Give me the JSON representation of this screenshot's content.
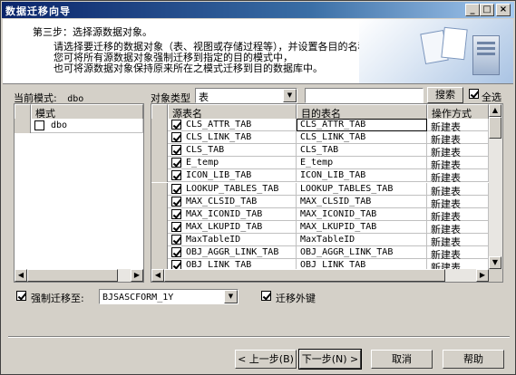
{
  "window": {
    "title": "数据迁移向导"
  },
  "header": {
    "step_title": "第三步：选择源数据对象。",
    "desc_lines": [
      "请选择要迁移的数据对象（表、视图或存储过程等），并设置各目的名称和迁移方式。",
      "您可将所有源数据对象强制迁移到指定的目的模式中，",
      "也可将源数据对象保持原来所在之模式迁移到目的数据库中。"
    ]
  },
  "schema": {
    "current_label": "当前模式:",
    "current_value": "dbo",
    "column_header": "模式",
    "rows": [
      {
        "name": "dbo",
        "checked": false
      }
    ]
  },
  "filter": {
    "object_type_label": "对象类型",
    "object_type_value": "表",
    "search_value": "",
    "search_button": "搜索",
    "select_all_label": "全选",
    "select_all_checked": true
  },
  "object_table": {
    "columns": [
      "源表名",
      "目的表名",
      "操作方式"
    ],
    "rows": [
      {
        "checked": true,
        "source": "CLS_ATTR_TAB",
        "target": "CLS_ATTR_TAB",
        "mode": "新建表"
      },
      {
        "checked": true,
        "source": "CLS_LINK_TAB",
        "target": "CLS_LINK_TAB",
        "mode": "新建表"
      },
      {
        "checked": true,
        "source": "CLS_TAB",
        "target": "CLS_TAB",
        "mode": "新建表"
      },
      {
        "checked": true,
        "source": "E_temp",
        "target": "E_temp",
        "mode": "新建表"
      },
      {
        "checked": true,
        "source": "ICON_LIB_TAB",
        "target": "ICON_LIB_TAB",
        "mode": "新建表"
      },
      {
        "checked": true,
        "source": "LOOKUP_TABLES_TAB",
        "target": "LOOKUP_TABLES_TAB",
        "mode": "新建表"
      },
      {
        "checked": true,
        "source": "MAX_CLSID_TAB",
        "target": "MAX_CLSID_TAB",
        "mode": "新建表"
      },
      {
        "checked": true,
        "source": "MAX_ICONID_TAB",
        "target": "MAX_ICONID_TAB",
        "mode": "新建表"
      },
      {
        "checked": true,
        "source": "MAX_LKUPID_TAB",
        "target": "MAX_LKUPID_TAB",
        "mode": "新建表"
      },
      {
        "checked": true,
        "source": "MaxTableID",
        "target": "MaxTableID",
        "mode": "新建表"
      },
      {
        "checked": true,
        "source": "OBJ_AGGR_LINK_TAB",
        "target": "OBJ_AGGR_LINK_TAB",
        "mode": "新建表"
      },
      {
        "checked": true,
        "source": "OBJ_LINK_TAB",
        "target": "OBJ_LINK_TAB",
        "mode": "新建表"
      }
    ]
  },
  "options": {
    "force_migrate_label": "强制迁移至:",
    "force_migrate_checked": true,
    "force_migrate_target": "BJSASCFORM_1Y",
    "migrate_fk_label": "迁移外键",
    "migrate_fk_checked": true
  },
  "footer": {
    "prev": "< 上一步(B)",
    "next": "下一步(N) >",
    "cancel": "取消",
    "help": "帮助"
  }
}
